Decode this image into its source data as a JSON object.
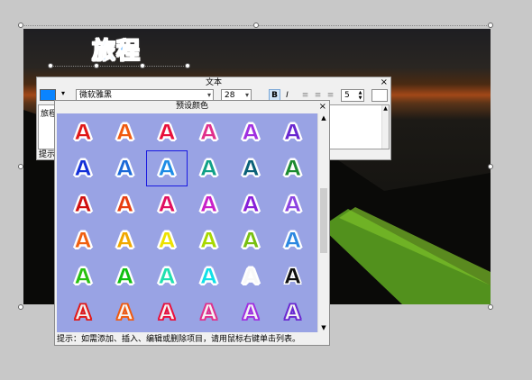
{
  "canvas": {
    "title_text": "旅程"
  },
  "text_dialog": {
    "title": "文本",
    "close": "×",
    "color": "#0a84ff",
    "font_name": "微软雅黑",
    "font_size": "28",
    "bold_label": "B",
    "italic_label": "I",
    "spacing_value": "5",
    "content": "旅程",
    "hint": "提示:"
  },
  "preset_colors": {
    "title": "预设颜色",
    "close": "×",
    "glyph": "A",
    "hint": "提示：如需添加、插入、编辑或删除项目，请用鼠标右键单击列表。",
    "selected_index": 8,
    "rows": [
      [
        "#e01818",
        "#f05a10",
        "#e8103c",
        "#e0308c",
        "#a030e0",
        "#6a28d0"
      ],
      [
        "#1430d8",
        "#1c6ad8",
        "#1e8ce6",
        "#10a088",
        "#0a6078",
        "#1c8a30"
      ],
      [
        "#d01010",
        "#e83e10",
        "#e01060",
        "#c820c8",
        "#8820d8",
        "#8c44e0"
      ],
      [
        "#f06010",
        "#f0a800",
        "#ece200",
        "#a8d800",
        "#78c010",
        "#2c88e0"
      ],
      [
        "#28c010",
        "#10c010",
        "#20e0b0",
        "#10e0e8",
        "#f8f8f8",
        "#101010"
      ],
      [
        "#f0f0f0",
        "#f4f4f4",
        "#f4f4f4",
        "#f4f4f4",
        "#f4f4f4",
        "#f4f4f4"
      ]
    ],
    "outline_row_strokes": [
      "#e01818",
      "#f05a10",
      "#e8103c",
      "#e0308c",
      "#a030e0",
      "#6a28d0"
    ]
  }
}
